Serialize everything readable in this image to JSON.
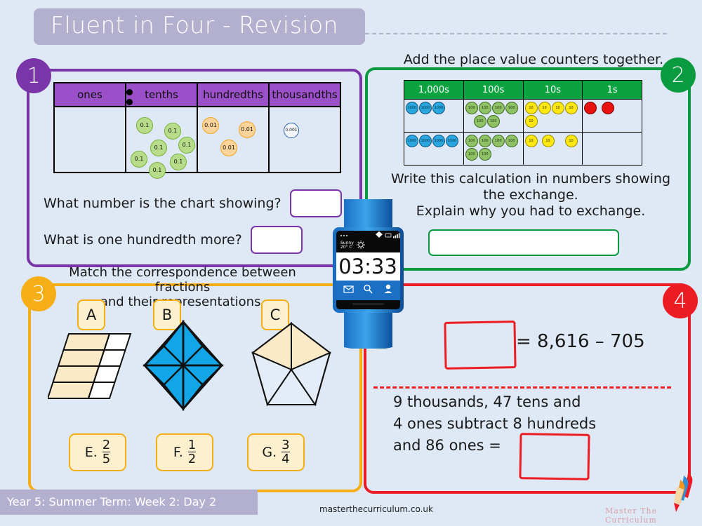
{
  "header": {
    "title": "Fluent in Four - Revision"
  },
  "section1": {
    "badge": "1",
    "columns": [
      "ones",
      "tenths",
      "hundredths",
      "thousandths"
    ],
    "counters": {
      "ones": [],
      "tenths": [
        "0.1",
        "0.1",
        "0.1",
        "0.1",
        "0.1",
        "0.1",
        "0.1"
      ],
      "hundredths": [
        "0.01",
        "0.01",
        "0.01"
      ],
      "thousandths": [
        "0.001"
      ]
    },
    "question1": "What number is the chart showing?",
    "question1_answer": "",
    "question2": "What is one hundredth more?",
    "question2_answer": ""
  },
  "section2": {
    "badge": "2",
    "title": "Add the place value counters together.",
    "columns": [
      "1,000s",
      "100s",
      "10s",
      "1s"
    ],
    "rows": [
      {
        "thousands": [
          "1000",
          "1000",
          "1000"
        ],
        "hundreds": [
          "100",
          "100",
          "100",
          "100",
          "100",
          "100"
        ],
        "tens": [
          "10",
          "10",
          "10",
          "10",
          "10"
        ],
        "ones": [
          "1",
          "1"
        ]
      },
      {
        "thousands": [
          "1000",
          "1000",
          "1000",
          "1000"
        ],
        "hundreds": [
          "100",
          "100",
          "100",
          "100",
          "100",
          "100"
        ],
        "tens": [
          "10",
          "10",
          "10"
        ],
        "ones": []
      }
    ],
    "instruction_line1": "Write this calculation in numbers showing",
    "instruction_line2": "the exchange.",
    "instruction_line3": "Explain why you had to exchange.",
    "answer": ""
  },
  "section3": {
    "badge": "3",
    "title_line1": "Match the correspondence between fractions",
    "title_line2": "and their representations.",
    "shapes": [
      {
        "label": "A",
        "type": "parallelogram-grid",
        "total": 8,
        "shaded": 4
      },
      {
        "label": "B",
        "type": "diamond-eighths",
        "total": 8,
        "shaded": 6
      },
      {
        "label": "C",
        "type": "pentagon-fifths",
        "total": 5,
        "shaded": 2
      }
    ],
    "fraction_cards": [
      {
        "label": "E.",
        "numerator": "2",
        "denominator": "5"
      },
      {
        "label": "F.",
        "numerator": "1",
        "denominator": "2"
      },
      {
        "label": "G.",
        "numerator": "3",
        "denominator": "4"
      }
    ]
  },
  "section4": {
    "badge": "4",
    "equation": "= 8,616 – 705",
    "answer1": "",
    "word_problem_line1": "9 thousands, 47 tens and",
    "word_problem_line2": "4 ones subtract 8 hundreds",
    "word_problem_line3": "and 86 ones =",
    "answer2": ""
  },
  "watch": {
    "time": "03:33",
    "weather_line1": "Sunny",
    "weather_line2": "20° C",
    "icons": [
      "menu-icon",
      "wifi-icon",
      "battery-icon",
      "signal-icon",
      "sun-icon",
      "mail-icon",
      "search-icon",
      "person-icon"
    ]
  },
  "footer": {
    "term_info": "Year 5: Summer Term: Week 2: Day 2",
    "website": "masterthecurriculum.co.uk",
    "logo_text": "Master The Curriculum"
  },
  "colors": {
    "background": "#dfe8f5",
    "title_bar": "#b3b0cf",
    "purple": "#7a35a8",
    "green": "#0a9a40",
    "amber": "#f5ae16",
    "red": "#ec1c24"
  }
}
